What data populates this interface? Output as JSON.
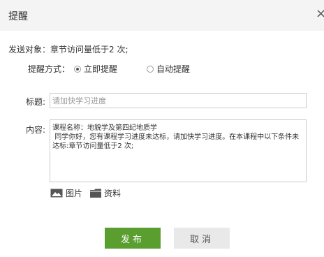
{
  "dialog": {
    "title": "提醒",
    "close_icon": "close-icon"
  },
  "form": {
    "target_label": "发送对象：",
    "target_value": "章节访问量低于2 次;",
    "method_label": "提醒方式：",
    "method_options": [
      {
        "label": "立即提醒",
        "checked": true
      },
      {
        "label": "自动提醒",
        "checked": false
      }
    ],
    "title_label": "标题:",
    "title_placeholder": "请加快学习进度",
    "title_value": "",
    "content_label": "内容:",
    "content_value": "课程名称：地貌学及第四纪地质学\n 同学你好，您有课程学习进度未达标，请加快学习进度。在本课程中以下条件未达标:章节访问量低于2 次;"
  },
  "attachments": {
    "image_label": "图片",
    "image_icon": "image-icon",
    "file_label": "资料",
    "file_icon": "folder-icon"
  },
  "buttons": {
    "publish_label": "发布",
    "cancel_label": "取消"
  },
  "colors": {
    "publish_bg": "#5a9e2f",
    "cancel_bg": "#e9e9e9",
    "header_bg": "#f4f4f4"
  }
}
